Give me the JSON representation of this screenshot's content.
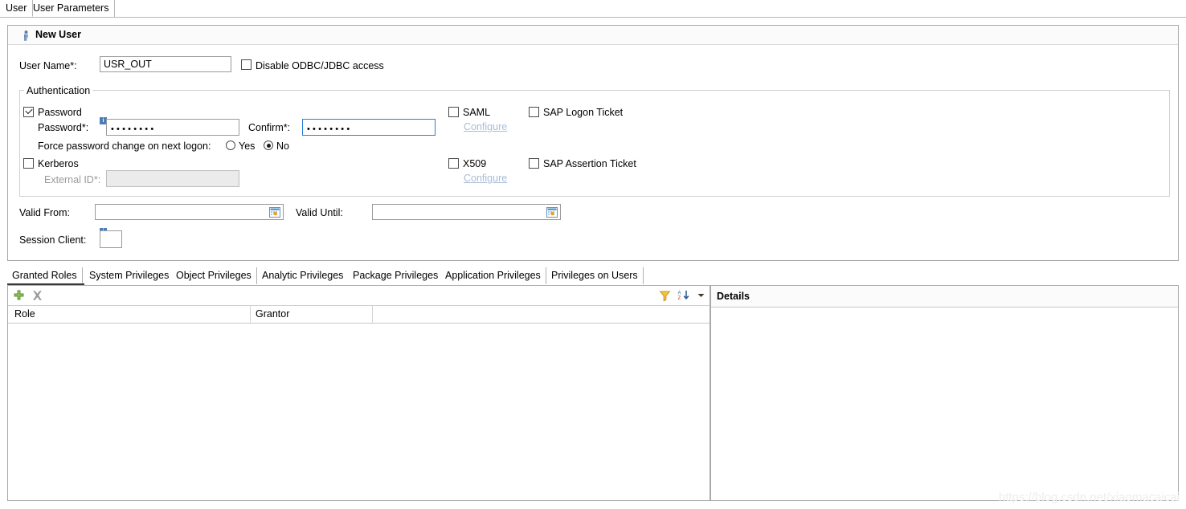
{
  "editor_tabs": [
    {
      "label": "User",
      "active": true
    },
    {
      "label": "User Parameters",
      "active": false
    }
  ],
  "panel": {
    "title": "New User",
    "icon": "user-person-icon"
  },
  "user_name": {
    "label": "User Name*:",
    "value": "USR_OUT"
  },
  "disable_odbc": {
    "label": "Disable ODBC/JDBC access",
    "checked": false
  },
  "authentication": {
    "legend": "Authentication",
    "password": {
      "label": "Password",
      "checked": true,
      "field_label": "Password*:",
      "value": "••••••••",
      "info_badge": "i",
      "focused": false
    },
    "confirm": {
      "label": "Confirm*:",
      "value": "••••••••",
      "focused": true
    },
    "force_change": {
      "label": "Force password change on next logon:",
      "options": [
        {
          "label": "Yes",
          "selected": false
        },
        {
          "label": "No",
          "selected": true
        }
      ]
    },
    "kerberos": {
      "label": "Kerberos",
      "checked": false,
      "field_label": "External ID*:",
      "value": "",
      "disabled": true
    },
    "saml": {
      "label": "SAML",
      "checked": false,
      "configure_link": "Configure"
    },
    "x509": {
      "label": "X509",
      "checked": false,
      "configure_link": "Configure"
    },
    "sap_logon_ticket": {
      "label": "SAP Logon Ticket",
      "checked": false
    },
    "sap_assertion_ticket": {
      "label": "SAP Assertion Ticket",
      "checked": false
    }
  },
  "valid_from": {
    "label": "Valid From:",
    "value": "",
    "icon": "calendar-icon"
  },
  "valid_until": {
    "label": "Valid Until:",
    "value": "",
    "icon": "calendar-icon"
  },
  "session_client": {
    "label": "Session Client:",
    "value": "",
    "info_badge": "i"
  },
  "privilege_tabs": [
    {
      "label": "Granted Roles",
      "active": true
    },
    {
      "label": "System Privileges",
      "active": false
    },
    {
      "label": "Object Privileges",
      "active": false
    },
    {
      "label": "Analytic Privileges",
      "active": false
    },
    {
      "label": "Package Privileges",
      "active": false
    },
    {
      "label": "Application Privileges",
      "active": false
    },
    {
      "label": "Privileges on Users",
      "active": false
    }
  ],
  "roles_toolbar": {
    "add": "add-icon",
    "remove": "remove-icon",
    "filter": "filter-icon",
    "sort": "sort-az-icon",
    "menu": "chevron-down-icon"
  },
  "roles_table": {
    "columns": [
      "Role",
      "Grantor",
      ""
    ],
    "rows": []
  },
  "details": {
    "title": "Details",
    "content": ""
  },
  "watermark": "https://blog.csdn.net/xiaomacaicai",
  "colors": {
    "accent_blue": "#2a7fd4",
    "badge_blue": "#4a7ebb",
    "link_blue": "#a9bcd6",
    "border_gray": "#a9a9a9",
    "disabled_gray": "#ebebeb",
    "plus_green": "#6aa84f",
    "filter_yellow": "#f5c242"
  }
}
